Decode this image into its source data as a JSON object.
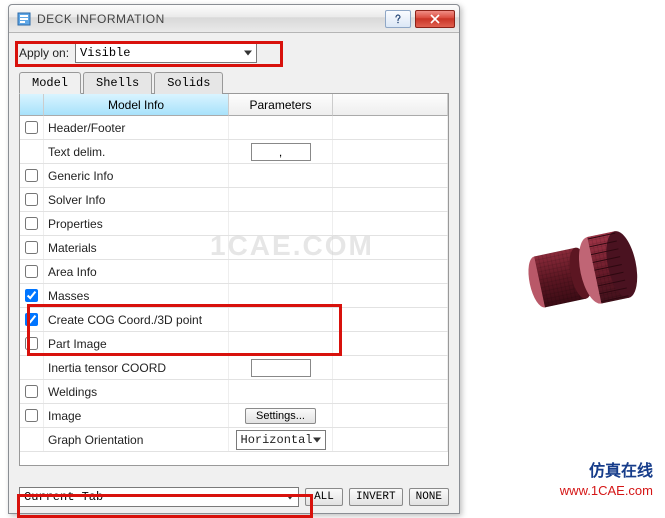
{
  "window": {
    "title": "DECK INFORMATION"
  },
  "apply": {
    "label": "Apply on:",
    "value": "Visible"
  },
  "tabs": [
    "Model",
    "Shells",
    "Solids"
  ],
  "headers": {
    "model_info": "Model Info",
    "parameters": "Parameters"
  },
  "rows": [
    {
      "label": "Header/Footer",
      "checked": false
    },
    {
      "label": "Text delim.",
      "nocb": true,
      "input": ","
    },
    {
      "label": "Generic Info",
      "checked": false
    },
    {
      "label": "Solver Info",
      "checked": false
    },
    {
      "label": "Properties",
      "checked": false
    },
    {
      "label": "Materials",
      "checked": false
    },
    {
      "label": "Area Info",
      "checked": false
    },
    {
      "label": "Masses",
      "checked": true
    },
    {
      "label": "Create COG Coord./3D point",
      "checked": true
    },
    {
      "label": "Part Image",
      "checked": false
    },
    {
      "label": "Inertia tensor COORD",
      "nocb": true,
      "input": ""
    },
    {
      "label": "Weldings",
      "checked": false
    },
    {
      "label": "Image",
      "checked": false,
      "button": "Settings..."
    },
    {
      "label": "Graph Orientation",
      "nocb": true,
      "combo": "Horizontal"
    }
  ],
  "footer": {
    "combo": "Current Tab",
    "buttons": [
      "ALL",
      "INVERT",
      "NONE"
    ]
  },
  "brand": {
    "cn": "仿真在线",
    "url": "www.1CAE.com"
  },
  "watermark": "1CAE.COM"
}
